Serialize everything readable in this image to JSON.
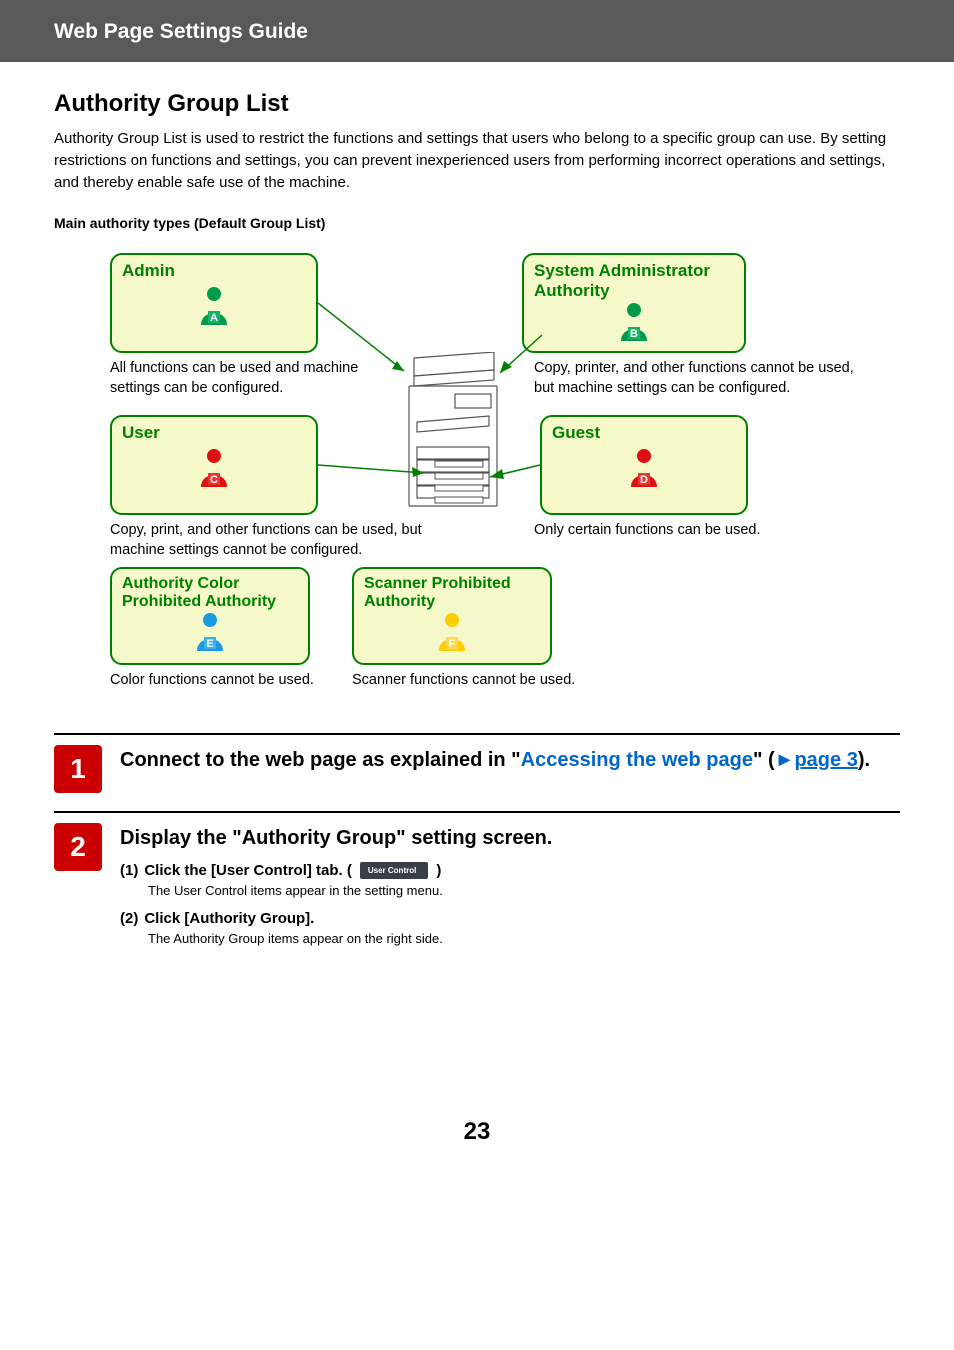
{
  "header": {
    "title": "Web Page Settings Guide"
  },
  "section": {
    "title": "Authority Group List",
    "intro": "Authority Group List is used to restrict the functions and settings that users who belong to a specific group can use. By setting restrictions on functions and settings, you can prevent inexperienced users from performing incorrect operations and settings, and thereby enable safe use of the machine.",
    "subhead": "Main authority types (Default Group List)"
  },
  "groups": {
    "admin": {
      "title": "Admin",
      "letter": "A",
      "desc": "All functions can be used and machine settings can be configured."
    },
    "sysadmin": {
      "title_l1": "System Administrator",
      "title_l2": "Authority",
      "letter": "B",
      "desc": "Copy, printer, and other functions cannot be used, but machine settings can be configured."
    },
    "user": {
      "title": "User",
      "letter": "C",
      "desc": "Copy, print, and other functions can be used, but machine settings cannot be configured."
    },
    "guest": {
      "title": "Guest",
      "letter": "D",
      "desc": "Only certain functions can be used."
    },
    "colorprohib": {
      "title_l1": "Authority Color",
      "title_l2": "Prohibited Authority",
      "letter": "E",
      "desc": "Color functions cannot be used."
    },
    "scanprohib": {
      "title_l1": "Scanner Prohibited",
      "title_l2": "Authority",
      "letter": "F",
      "desc": "Scanner functions cannot be used."
    }
  },
  "steps": {
    "s1": {
      "num": "1",
      "prefix": "Connect to the web page as explained in \"",
      "link1": "Accessing the web page",
      "mid": "\" (",
      "arrow": "►",
      "link2": "page 3",
      "suffix": ")."
    },
    "s2": {
      "num": "2",
      "title": "Display the \"Authority Group\" setting screen.",
      "sub1": {
        "marker": "(1)",
        "text": "Click the [User Control] tab. (",
        "chip": "User Control",
        "close": ")",
        "desc": "The User Control items appear in the setting menu."
      },
      "sub2": {
        "marker": "(2)",
        "text": "Click [Authority Group].",
        "desc": "The Authority Group items appear on the right side."
      }
    }
  },
  "page_number": "23"
}
